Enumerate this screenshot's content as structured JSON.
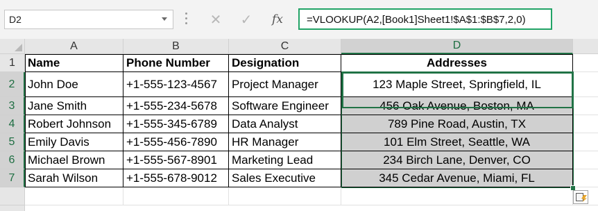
{
  "formula_bar": {
    "name_box": "D2",
    "cancel_icon": "✕",
    "enter_icon": "✓",
    "fx_label": "fx",
    "formula": "=VLOOKUP(A2,[Book1]Sheet1!$A$1:$B$7,2,0)"
  },
  "columns": [
    "A",
    "B",
    "C",
    "D"
  ],
  "rows": [
    "1",
    "2",
    "3",
    "4",
    "5",
    "6",
    "7"
  ],
  "table": {
    "headers": [
      "Name",
      "Phone Number",
      "Designation",
      "Addresses"
    ],
    "data": [
      [
        "John Doe",
        "+1-555-123-4567",
        "Project Manager",
        "123 Maple Street, Springfield, IL"
      ],
      [
        "Jane Smith",
        "+1-555-234-5678",
        "Software Engineer",
        "456 Oak Avenue, Boston, MA"
      ],
      [
        "Robert Johnson",
        "+1-555-345-6789",
        "Data Analyst",
        "789 Pine Road, Austin, TX"
      ],
      [
        "Emily Davis",
        "+1-555-456-7890",
        "HR Manager",
        "101 Elm Street, Seattle, WA"
      ],
      [
        "Michael Brown",
        "+1-555-567-8901",
        "Marketing Lead",
        "234 Birch Lane, Denver, CO"
      ],
      [
        "Sarah Wilson",
        "+1-555-678-9012",
        "Sales Executive",
        "345 Cedar Avenue, Miami, FL"
      ]
    ]
  },
  "colors": {
    "accent": "#217346",
    "selection_fill": "#d0d0d0",
    "header_bg": "#e6e6e6"
  },
  "icons": {
    "quick_analysis": "quick-analysis-icon"
  }
}
